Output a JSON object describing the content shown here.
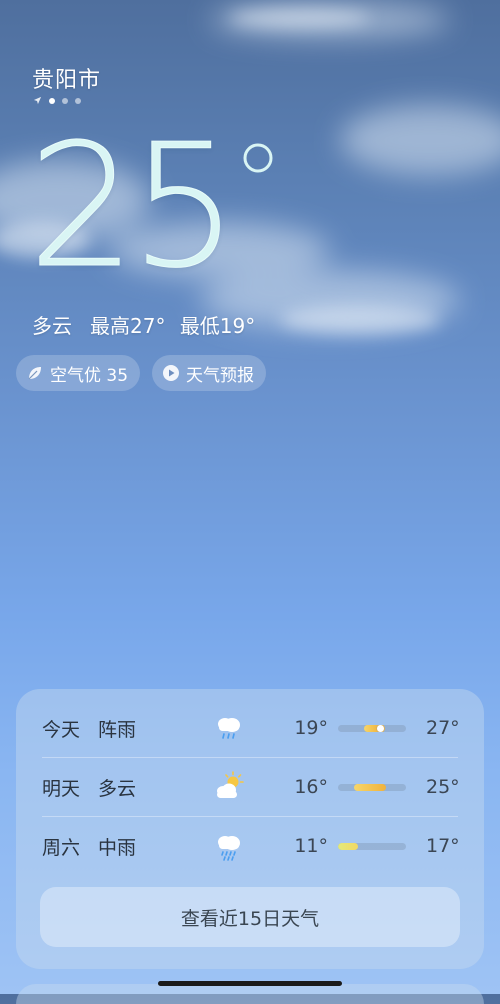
{
  "location": {
    "city": "贵阳市",
    "page_indicator": {
      "count": 3,
      "active_index": 0
    }
  },
  "current": {
    "temperature": "25",
    "condition": "多云",
    "high_label": "最高27°",
    "low_label": "最低19°"
  },
  "chips": {
    "air_quality": "空气优 35",
    "forecast_video": "天气预报"
  },
  "forecast": [
    {
      "day": "今天",
      "condition": "阵雨",
      "icon": "shower-icon",
      "low": "19°",
      "high": "27°",
      "range_start": 0.38,
      "range_end": 0.62,
      "current": 0.62
    },
    {
      "day": "明天",
      "condition": "多云",
      "icon": "partly-cloudy-icon",
      "low": "16°",
      "high": "25°",
      "range_start": 0.24,
      "range_end": 0.7,
      "current": null
    },
    {
      "day": "周六",
      "condition": "中雨",
      "icon": "moderate-rain-icon",
      "low": "11°",
      "high": "17°",
      "range_start": 0.0,
      "range_end": 0.3,
      "current": null
    }
  ],
  "more_button": "查看近15日天气",
  "colors": {
    "accent_bar": "#f0b23c",
    "text_dark": "#2a3440"
  }
}
